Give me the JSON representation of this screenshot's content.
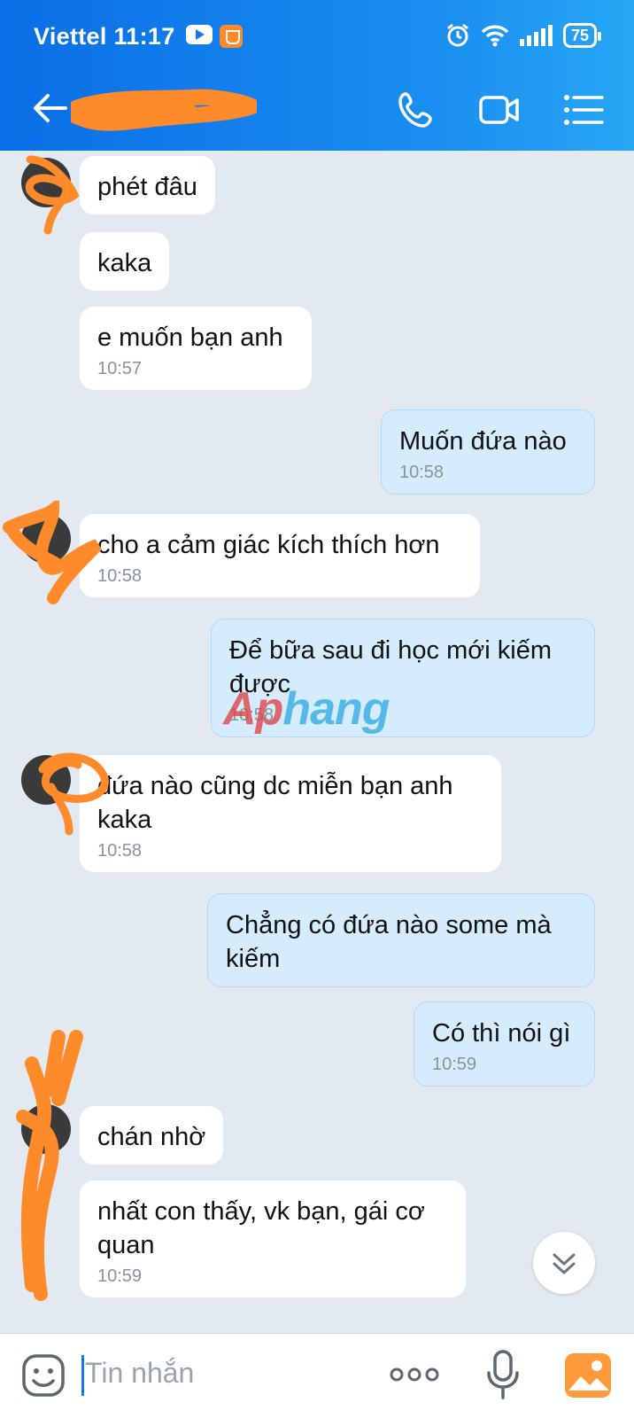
{
  "status_bar": {
    "carrier": "Viettel",
    "time": "11:17",
    "battery": "75"
  },
  "header": {
    "back_icon": "arrow-left-icon",
    "contact_name": "",
    "call_icon": "phone-icon",
    "video_icon": "video-camera-icon",
    "menu_icon": "list-menu-icon"
  },
  "messages": [
    {
      "direction": "in",
      "text": "phét đâu",
      "time": ""
    },
    {
      "direction": "in",
      "text": "kaka",
      "time": ""
    },
    {
      "direction": "in",
      "text": "e muốn bạn anh",
      "time": "10:57"
    },
    {
      "direction": "out",
      "text": "Muốn đứa nào",
      "time": "10:58"
    },
    {
      "direction": "in",
      "text": "cho a cảm giác kích thích hơn",
      "time": "10:58"
    },
    {
      "direction": "out",
      "text": "Để bữa sau đi học mới kiếm\nđược",
      "time": "10:58"
    },
    {
      "direction": "in",
      "text": "đứa nào cũng dc miễn bạn anh\nkaka",
      "time": "10:58"
    },
    {
      "direction": "out",
      "text": "Chẳng có đứa nào some mà\nkiếm",
      "time": ""
    },
    {
      "direction": "out",
      "text": "Có thì nói gì",
      "time": "10:59"
    },
    {
      "direction": "in",
      "text": "chán nhờ",
      "time": ""
    },
    {
      "direction": "in",
      "text": "nhất con thấy, vk bạn, gái cơ\nquan",
      "time": "10:59"
    }
  ],
  "watermark": {
    "part1": "Ap",
    "part2": "hang"
  },
  "input_bar": {
    "placeholder": "Tin nhắn",
    "emoji_icon": "emoji-icon",
    "more_icon": "more-dots-icon",
    "mic_icon": "microphone-icon",
    "gallery_icon": "gallery-icon"
  },
  "colors": {
    "header_start": "#0a6ee6",
    "header_end": "#28a6f5",
    "chat_bg": "#e2e9f1",
    "incoming_bubble": "#ffffff",
    "outgoing_bubble": "#d5ecfd",
    "redaction": "#ff8a2a"
  }
}
